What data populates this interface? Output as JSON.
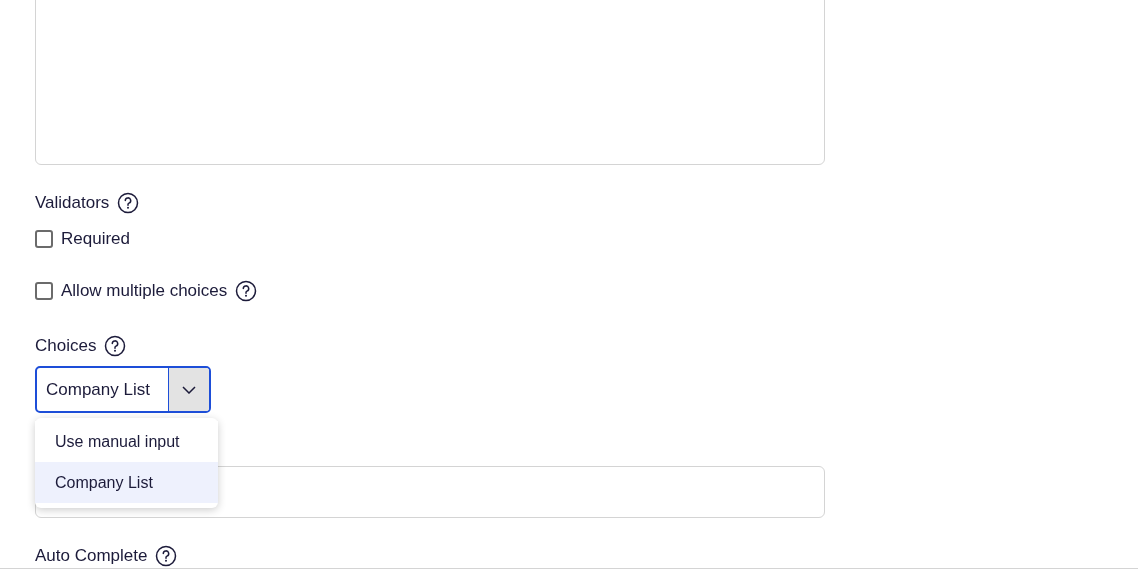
{
  "validators": {
    "label": "Validators",
    "options": [
      {
        "label": "Required",
        "checked": false
      }
    ]
  },
  "multiple": {
    "label": "Allow multiple choices",
    "checked": false
  },
  "choices": {
    "label": "Choices",
    "value": "Company List",
    "expanded": true,
    "options": [
      {
        "label": "Use manual input",
        "selected": false
      },
      {
        "label": "Company List",
        "selected": true
      }
    ]
  },
  "auto_complete": {
    "label": "Auto Complete"
  }
}
